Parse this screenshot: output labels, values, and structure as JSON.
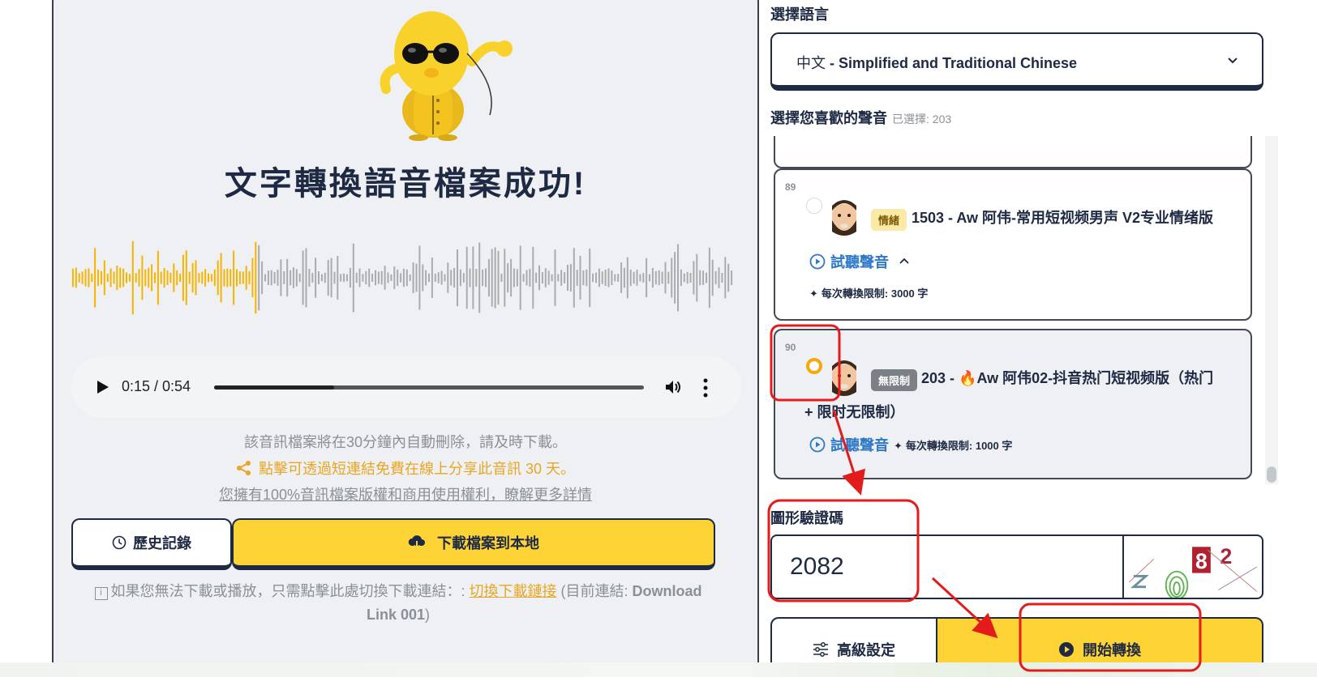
{
  "result": {
    "title": "文字轉換語音檔案成功!",
    "audio": {
      "time": "0:15 / 0:54",
      "progress": 0.28
    },
    "notice_delete": "該音訊檔案將在30分鐘內自動刪除，請及時下載。",
    "notice_share": "點擊可透過短連結免費在線上分享此音訊 30 天。",
    "notice_rights": "您擁有100%音訊檔案版權和商用使用權利，瞭解更多詳情",
    "history_button": "歷史記錄",
    "download_button": "下載檔案到本地",
    "fallback": {
      "prefix": "如果您無法下載或播放，只需點擊此處切換下載連結：: ",
      "link": "切換下載鏈接",
      "middle": " (目前連結: ",
      "current": "Download Link 001",
      "suffix": ")"
    }
  },
  "language": {
    "label": "選擇語言",
    "name": "中文",
    "desc": " - Simplified and Traditional Chinese"
  },
  "voices": {
    "label": "選擇您喜歡的聲音",
    "selected_count": "已選擇: 203",
    "items": [
      {
        "number": "89",
        "badge": "情緒",
        "name": "1503 - Aw 阿伟-常用短视频男声 V2专业情绪版",
        "listen": "試聽聲音",
        "limit": "每次轉換限制: 3000 字"
      },
      {
        "number": "90",
        "badge": "無限制",
        "name_part1": "203 - ",
        "name_part2": "Aw 阿伟02-抖音热门短视频版（热门",
        "name_part3": "+ 限时无限制）",
        "listen": "試聽聲音",
        "limit": "每次轉換限制: 1000 字"
      }
    ]
  },
  "captcha": {
    "label": "圖形驗證碼",
    "value": "2082",
    "image_digits": [
      "8",
      "2"
    ]
  },
  "actions": {
    "advanced": "高級設定",
    "start": "開始轉換"
  },
  "colors": {
    "accent_yellow": "#fdd335",
    "navy": "#1e2a44",
    "link_blue": "#2d78c8",
    "annotation_red": "#e41b1b",
    "radio_orange": "#f5a811"
  },
  "icons": [
    "play-icon",
    "volume-icon",
    "more-vert-icon",
    "share-icon",
    "clock-icon",
    "cloud-download-icon",
    "info-icon",
    "chevron-down-icon",
    "play-circle-icon",
    "chevron-up-icon",
    "sparkle-icon",
    "fire-icon",
    "sliders-icon"
  ]
}
